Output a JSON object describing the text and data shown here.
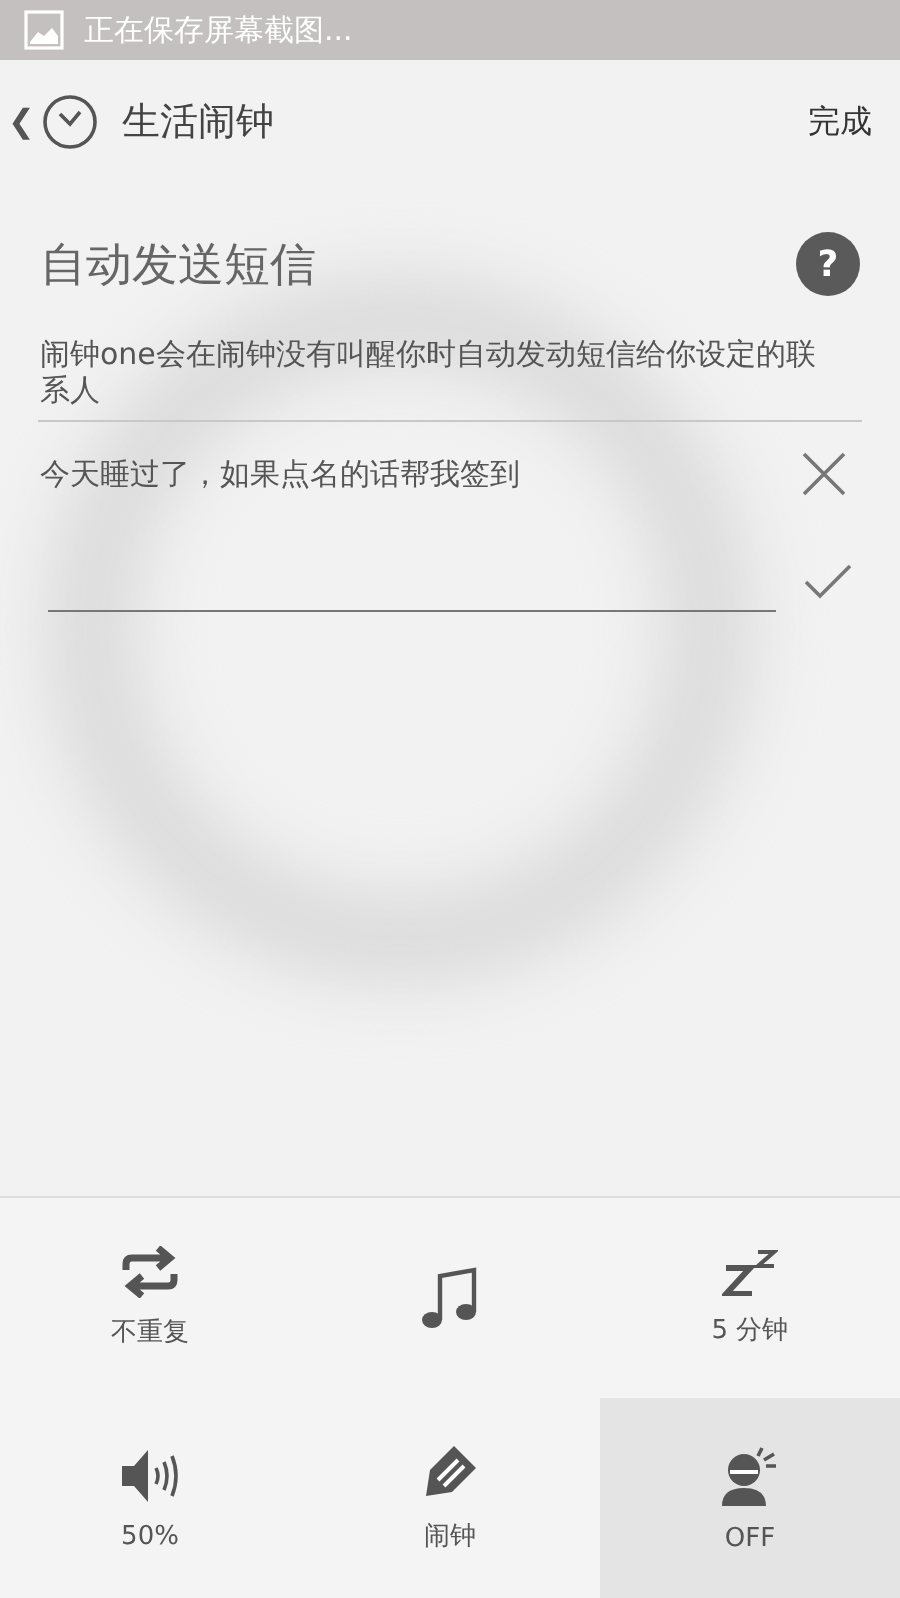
{
  "status_bar": {
    "notification": "正在保存屏幕截图..."
  },
  "header": {
    "back": "❮",
    "title": "生活闹钟",
    "done": "完成"
  },
  "section": {
    "title": "自动发送短信",
    "description": "闹钟one会在闹钟没有叫醒你时自动发动短信给你设定的联系人"
  },
  "message": {
    "text": "今天睡过了，如果点名的话帮我签到"
  },
  "help": {
    "symbol": "?"
  },
  "options": [
    {
      "kind": "repeat",
      "label": "不重复",
      "selected": false
    },
    {
      "kind": "music",
      "selected": false
    },
    {
      "kind": "snooze",
      "label": "5 分钟",
      "selected": false
    },
    {
      "kind": "volume",
      "label": "50%",
      "selected": false
    },
    {
      "kind": "label",
      "label": "闹钟",
      "selected": false
    },
    {
      "kind": "person",
      "label": "OFF",
      "selected": true
    }
  ]
}
